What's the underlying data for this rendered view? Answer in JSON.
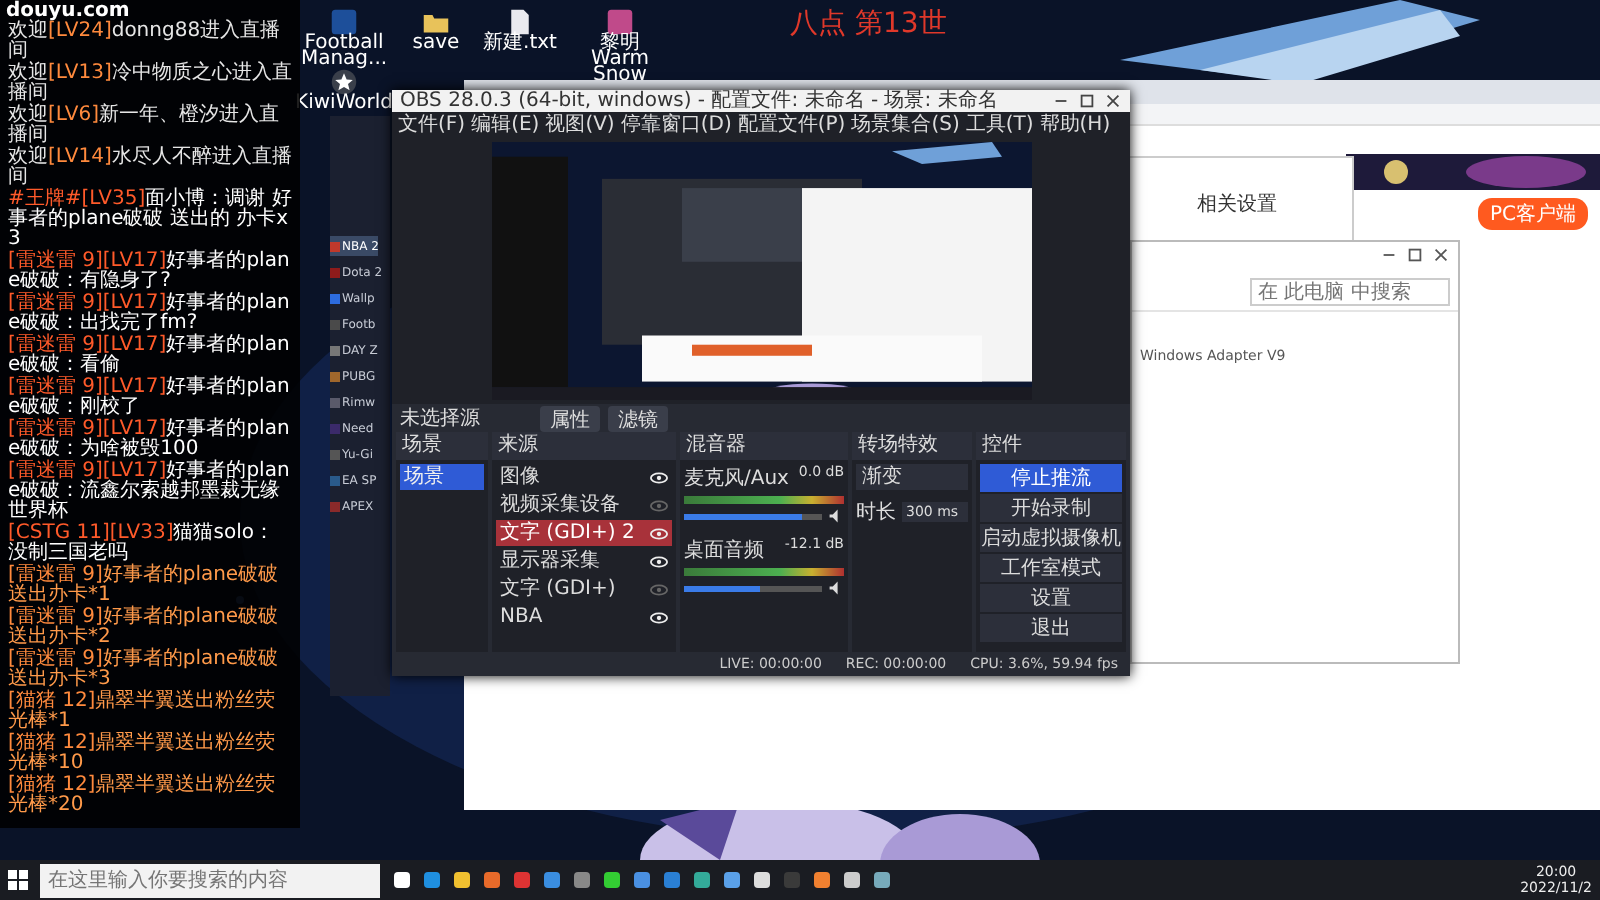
{
  "stream_title": "八点 第13世",
  "desktop_icons": [
    {
      "label": "Football Manag...",
      "kind": "badge"
    },
    {
      "label": "save",
      "kind": "folder"
    },
    {
      "label": "新建.txt",
      "kind": "file"
    },
    {
      "label": "黎明 Warm Snow",
      "kind": "game"
    },
    {
      "label": "KiwiWorld",
      "kind": "star"
    }
  ],
  "chat": {
    "site": "douyu.com",
    "messages": [
      {
        "kind": "welcome",
        "prefix": "欢迎",
        "badge": "[LV24]",
        "text": "donng88进入直播间"
      },
      {
        "kind": "welcome",
        "prefix": "欢迎",
        "badge": "[LV13]",
        "text": "冷中物质之心进入直播间"
      },
      {
        "kind": "welcome",
        "prefix": "欢迎",
        "badge": "[LV6]",
        "text": "新一年、橙汐进入直播间"
      },
      {
        "kind": "welcome",
        "prefix": "欢迎",
        "badge": "[LV14]",
        "text": "水尽人不醉进入直播间"
      },
      {
        "kind": "message",
        "badge": "#王牌#[LV35]",
        "text": "面小博：调谢 好事者的plane破破 送出的 办卡x3"
      },
      {
        "kind": "message",
        "badge": "[雷迷雷 9][LV17]",
        "text": "好事者的plane破破：有隐身了?"
      },
      {
        "kind": "message",
        "badge": "[雷迷雷 9][LV17]",
        "text": "好事者的plane破破：出找完了fm?"
      },
      {
        "kind": "message",
        "badge": "[雷迷雷 9][LV17]",
        "text": "好事者的plane破破：看偷"
      },
      {
        "kind": "message",
        "badge": "[雷迷雷 9][LV17]",
        "text": "好事者的plane破破：刚校了"
      },
      {
        "kind": "message",
        "badge": "[雷迷雷 9][LV17]",
        "text": "好事者的plane破破：为啥被毁100"
      },
      {
        "kind": "message",
        "badge": "[雷迷雷 9][LV17]",
        "text": "好事者的plane破破：流鑫尔索越邦墨裁无缘世界杯"
      },
      {
        "kind": "message",
        "badge": "[CSTG 11][LV33]",
        "text": "猫猫solo：没制三国老吗"
      },
      {
        "kind": "gift",
        "badge": "[雷迷雷 9]",
        "text": "好事者的plane破破送出办卡*1"
      },
      {
        "kind": "gift",
        "badge": "[雷迷雷 9]",
        "text": "好事者的plane破破送出办卡*2"
      },
      {
        "kind": "gift",
        "badge": "[雷迷雷 9]",
        "text": "好事者的plane破破送出办卡*3"
      },
      {
        "kind": "gift",
        "badge": "[猫猪 12]",
        "text": "鼎翠半翼送出粉丝荧光棒*1"
      },
      {
        "kind": "gift",
        "badge": "[猫猪 12]",
        "text": "鼎翠半翼送出粉丝荧光棒*10"
      },
      {
        "kind": "gift",
        "badge": "[猫猪 12]",
        "text": "鼎翠半翼送出粉丝荧光棒*20"
      }
    ]
  },
  "game_library": {
    "games": [
      {
        "name": "NBA 2",
        "selected": true
      },
      {
        "name": "Dota 2",
        "selected": false
      },
      {
        "name": "Wallp",
        "selected": false
      },
      {
        "name": "Footb",
        "selected": false
      },
      {
        "name": "DAY Z",
        "selected": false
      },
      {
        "name": "PUBG",
        "selected": false
      },
      {
        "name": "Rimw",
        "selected": false
      },
      {
        "name": "Need",
        "selected": false
      },
      {
        "name": "Yu-Gi",
        "selected": false
      },
      {
        "name": "EA SP",
        "selected": false
      },
      {
        "name": "APEX",
        "selected": false
      }
    ]
  },
  "obs": {
    "title": "OBS 28.0.3 (64-bit, windows) - 配置文件: 未命名 - 场景: 未命名",
    "menu": [
      "文件(F)",
      "编辑(E)",
      "视图(V)",
      "停靠窗口(D)",
      "配置文件(P)",
      "场景集合(S)",
      "工具(T)",
      "帮助(H)"
    ],
    "toolbar": {
      "status": "未选择源",
      "buttons": [
        "属性",
        "滤镜"
      ]
    },
    "docks": {
      "scenes": "场景",
      "sources": "来源",
      "mixer": "混音器",
      "transitions": "转场特效",
      "controls": "控件"
    },
    "scenes": [
      {
        "name": "场景",
        "selected": true
      }
    ],
    "sources": [
      {
        "name": "图像",
        "selected": false,
        "visible": true
      },
      {
        "name": "视频采集设备",
        "selected": false,
        "visible": false
      },
      {
        "name": "文字 (GDI+) 2",
        "selected": true,
        "visible": true
      },
      {
        "name": "显示器采集",
        "selected": false,
        "visible": true
      },
      {
        "name": "文字 (GDI+)",
        "selected": false,
        "visible": false
      },
      {
        "name": "NBA",
        "selected": false,
        "visible": true
      }
    ],
    "mixer": [
      {
        "name": "麦克风/Aux",
        "reading": "0.0 dB",
        "level": 0.85
      },
      {
        "name": "桌面音频",
        "reading": "-12.1 dB",
        "level": 0.55
      }
    ],
    "transition": {
      "type": "渐变",
      "duration_label": "时长",
      "duration": "300 ms"
    },
    "controls": [
      {
        "label": "停止推流",
        "selected": true
      },
      {
        "label": "开始录制",
        "selected": false
      },
      {
        "label": "启动虚拟摄像机",
        "selected": false
      },
      {
        "label": "工作室模式",
        "selected": false
      },
      {
        "label": "设置",
        "selected": false
      },
      {
        "label": "退出",
        "selected": false
      }
    ],
    "status": {
      "live": "LIVE: 00:00:00",
      "rec": "REC: 00:00:00",
      "cpu": "CPU: 3.6%, 59.94 fps"
    }
  },
  "settings_window": {
    "title": "相关设置"
  },
  "explorer": {
    "search_placeholder": "在 此电脑 中搜索",
    "items": [
      "Windows Adapter V9"
    ]
  },
  "browser": {
    "client_button": "PC客户端"
  },
  "taskbar": {
    "search_placeholder": "在这里输入你要搜索的内容",
    "time": "20:00",
    "date": "2022/11/2"
  }
}
